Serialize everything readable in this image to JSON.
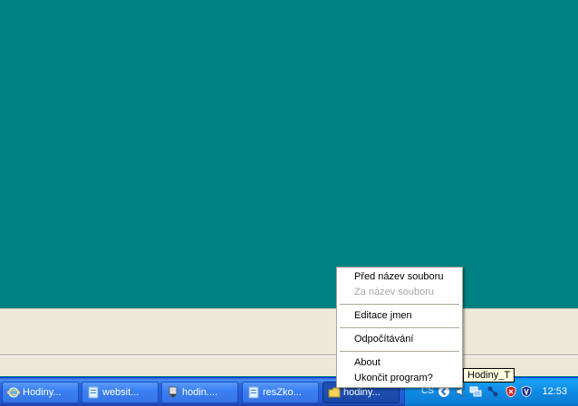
{
  "context_menu": {
    "items": [
      {
        "label": "Před název souboru",
        "enabled": true
      },
      {
        "label": "Za název souboru",
        "enabled": false
      },
      {
        "label": "Editace jmen",
        "enabled": true
      },
      {
        "label": "Odpočítávání",
        "enabled": true
      },
      {
        "label": "About",
        "enabled": true
      },
      {
        "label": "Ukončit program?",
        "enabled": true
      }
    ]
  },
  "tooltip": "Hodiny_T",
  "taskbar": {
    "buttons": [
      {
        "label": "Hodiny...",
        "icon": "ie-icon"
      },
      {
        "label": "websit...",
        "icon": "document-icon"
      },
      {
        "label": "hodin....",
        "icon": "shield-doc-icon"
      },
      {
        "label": "resZko...",
        "icon": "document-icon"
      },
      {
        "label": "hodiny...",
        "icon": "folder-icon"
      }
    ],
    "tray": {
      "lang": "CS",
      "time": "12:53",
      "icons": [
        "arrow-icon",
        "speaker-icon",
        "network-icon",
        "connection-icon",
        "security-alert-icon",
        "antivirus-icon"
      ]
    }
  },
  "colors": {
    "desktop": "#008080",
    "taskbar": "#245edb",
    "tray": "#0f8ae1",
    "window": "#ECE9D8"
  }
}
